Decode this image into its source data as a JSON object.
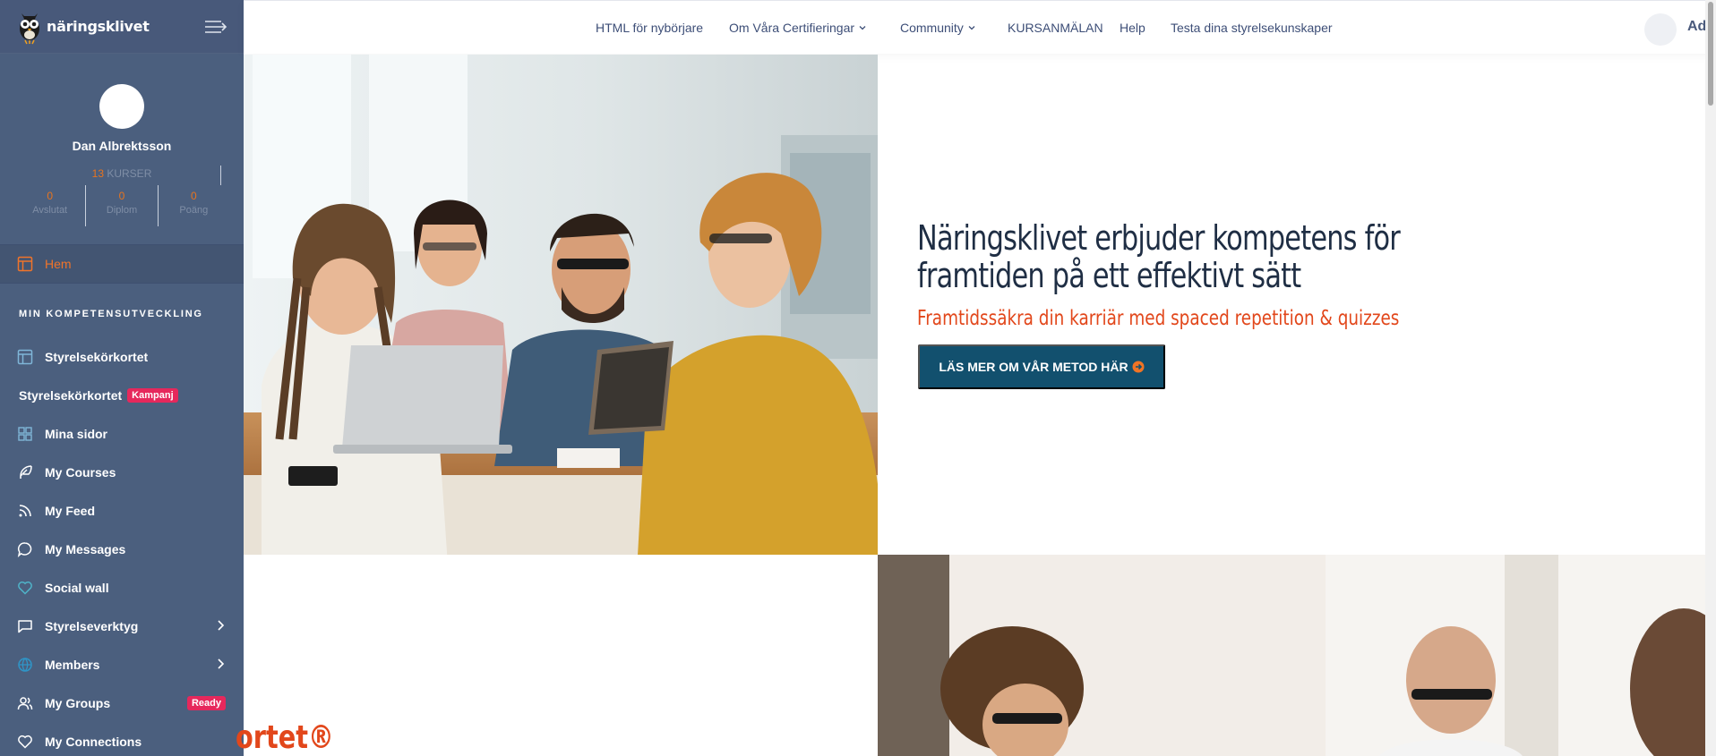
{
  "brand": {
    "name": "näringsklivet"
  },
  "profile": {
    "name": "Dan Albrektsson",
    "courses_count": "13",
    "courses_label": "KURSER",
    "stats": [
      {
        "value": "0",
        "label": "Avslutat"
      },
      {
        "value": "0",
        "label": "Diplom"
      },
      {
        "value": "0",
        "label": "Poäng"
      }
    ]
  },
  "sidebar": {
    "home": "Hem",
    "section_title": "MIN KOMPETENSUTVECKLING",
    "items": [
      {
        "label": "Styrelsekörkortet",
        "icon": "layout-icon"
      },
      {
        "label": "Styrelsekörkortet",
        "badge": "Kampanj"
      },
      {
        "label": "Mina sidor",
        "icon": "grid-icon"
      },
      {
        "label": "My Courses",
        "icon": "feather-icon"
      },
      {
        "label": "My Feed",
        "icon": "rss-icon"
      },
      {
        "label": "My Messages",
        "icon": "chat-icon"
      },
      {
        "label": "Social wall",
        "icon": "heart-icon"
      },
      {
        "label": "Styrelseverktyg",
        "icon": "message-square-icon"
      },
      {
        "label": "Members",
        "icon": "globe-icon"
      },
      {
        "label": "My Groups",
        "icon": "users-icon",
        "badge": "Ready"
      },
      {
        "label": "My Connections",
        "icon": "heart-icon"
      }
    ]
  },
  "topnav": {
    "items": [
      {
        "label": "HTML för nybörjare"
      },
      {
        "label": "Om Våra Certifieringar"
      },
      {
        "label": "Community"
      },
      {
        "label": "KURSANMÄLAN"
      },
      {
        "label": "Help"
      },
      {
        "label": "Testa dina styrelsekunskaper"
      }
    ],
    "user": "Admin"
  },
  "hero": {
    "title": "Näringsklivet erbjuder kompetens för framtiden på ett effektivt sätt",
    "subtitle": "Framtidssäkra din karriär med spaced repetition & quizzes",
    "button": "LÄS MER OM VÅR METOD HÄR"
  },
  "section2": {
    "partial_title": "ortet®"
  },
  "colors": {
    "sidebar": "#4b5f7e",
    "accent": "#e2471b",
    "button": "#12506e",
    "badge": "#e6285c"
  }
}
